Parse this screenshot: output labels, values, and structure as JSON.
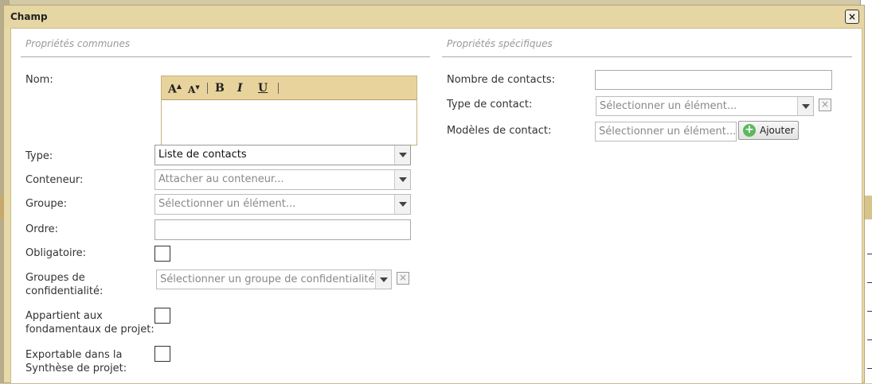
{
  "dialog": {
    "title": "Champ",
    "close_icon": "×"
  },
  "left_section": {
    "title": "Propriétés communes",
    "nom_label": "Nom:",
    "type_label": "Type:",
    "type_value": "Liste de contacts",
    "conteneur_label": "Conteneur:",
    "conteneur_placeholder": "Attacher au conteneur...",
    "groupe_label": "Groupe:",
    "groupe_placeholder": "Sélectionner un élément...",
    "ordre_label": "Ordre:",
    "obligatoire_label": "Obligatoire:",
    "groupes_conf_label_1": "Groupes de",
    "groupes_conf_label_2": "confidentialité:",
    "groupes_conf_placeholder": "Sélectionner un groupe de confidentialité...",
    "fondamentaux_label_1": "Appartient aux",
    "fondamentaux_label_2": "fondamentaux de projet:",
    "exportable_label_1": "Exportable dans la",
    "exportable_label_2": "Synthèse de projet:"
  },
  "editor_toolbar": {
    "grow_font": "A",
    "shrink_font": "A",
    "bold": "B",
    "italic": "I",
    "underline": "U"
  },
  "right_section": {
    "title": "Propriétés spécifiques",
    "nombre_label": "Nombre de contacts:",
    "type_contact_label": "Type de contact:",
    "type_contact_placeholder": "Sélectionner un élément...",
    "modeles_label": "Modèles de contact:",
    "modeles_placeholder": "Sélectionner un élément...",
    "add_label": "Ajouter"
  }
}
